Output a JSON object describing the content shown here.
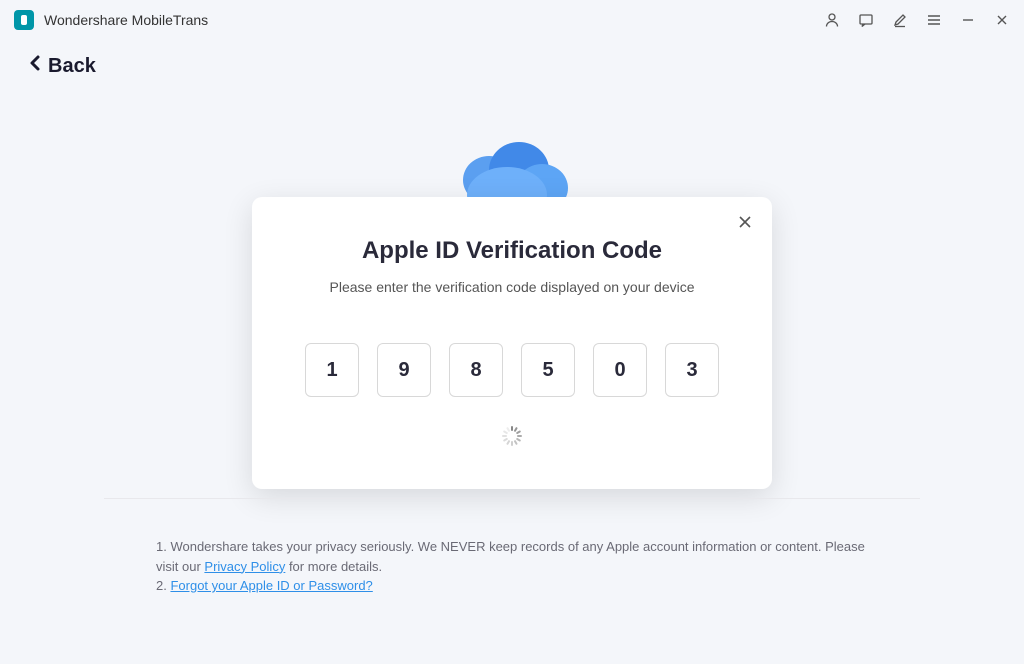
{
  "app": {
    "title": "Wondershare MobileTrans"
  },
  "nav": {
    "back_label": "Back"
  },
  "modal": {
    "title": "Apple ID  Verification Code",
    "subtitle": "Please enter the verification code displayed on your device",
    "code": [
      "1",
      "9",
      "8",
      "5",
      "0",
      "3"
    ]
  },
  "footer": {
    "note1_prefix": "1. Wondershare takes your privacy seriously. We NEVER keep records of any Apple account information or content. Please visit our ",
    "note1_link": " Privacy Policy",
    "note1_suffix": " for more details.",
    "note2_prefix": "2. ",
    "note2_link": "Forgot your Apple ID or Password?"
  }
}
